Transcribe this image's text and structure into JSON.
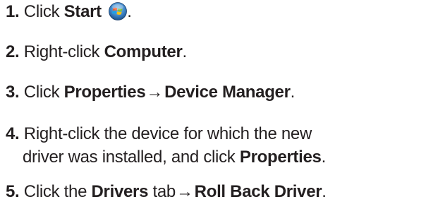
{
  "steps": [
    {
      "number": "1.",
      "pre": "Click ",
      "bold": "Start",
      "icon": "windows-start-orb-icon",
      "post": "."
    },
    {
      "number": "2.",
      "pre": "Right-click ",
      "bold": "Computer",
      "post": "."
    },
    {
      "number": "3.",
      "pre": "Click ",
      "bold": "Properties",
      "arrow": "→",
      "bold2": "Device Manager",
      "post": "."
    },
    {
      "number": "4.",
      "line1": "Right-click the device for which the new",
      "line2_pre": "driver was installed, and click ",
      "bold": "Properties",
      "post": "."
    },
    {
      "number": "5.",
      "pre": "Click the ",
      "bold": "Drivers",
      "mid": " tab",
      "arrow": "→",
      "bold2": "Roll Back Driver",
      "post": "."
    }
  ]
}
